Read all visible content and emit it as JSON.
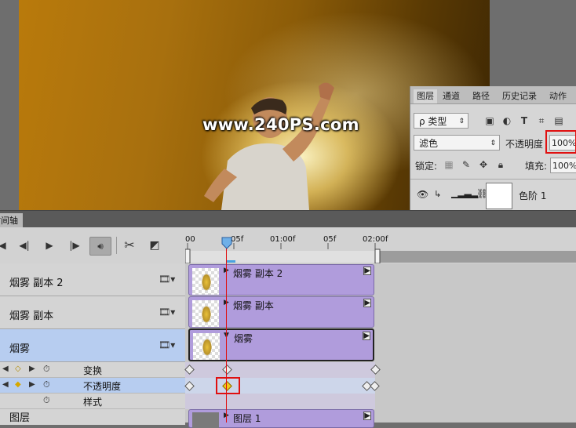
{
  "canvas": {
    "watermark": "www.240PS.com"
  },
  "layers_panel": {
    "tabs": [
      "图层",
      "通道",
      "路径",
      "历史记录",
      "动作"
    ],
    "filter_label": "ρ 类型",
    "blend_mode": "滤色",
    "opacity_label": "不透明度",
    "opacity_value": "100%",
    "lock_label": "锁定:",
    "fill_label": "填充:",
    "fill_value": "100%",
    "layer_name": "色阶 1"
  },
  "timeline": {
    "title": "时间轴",
    "ruler_labels": [
      "00",
      "05f",
      "01:00f",
      "05f",
      "02:00f"
    ],
    "tracks": [
      {
        "name": "烟雾 副本 2",
        "clip_name": "烟雾 副本 2"
      },
      {
        "name": "烟雾 副本",
        "clip_name": "烟雾 副本"
      },
      {
        "name": "烟雾",
        "clip_name": "烟雾"
      }
    ],
    "properties": [
      "变换",
      "不透明度",
      "样式"
    ],
    "bottom_clip_name": "图层 1",
    "bottom_track_name": "图层"
  },
  "colors": {
    "clip": "#b09cdc",
    "selected_row": "#b7cdf0",
    "playhead": "#e01010",
    "keyframe_active": "#f2c81a"
  }
}
